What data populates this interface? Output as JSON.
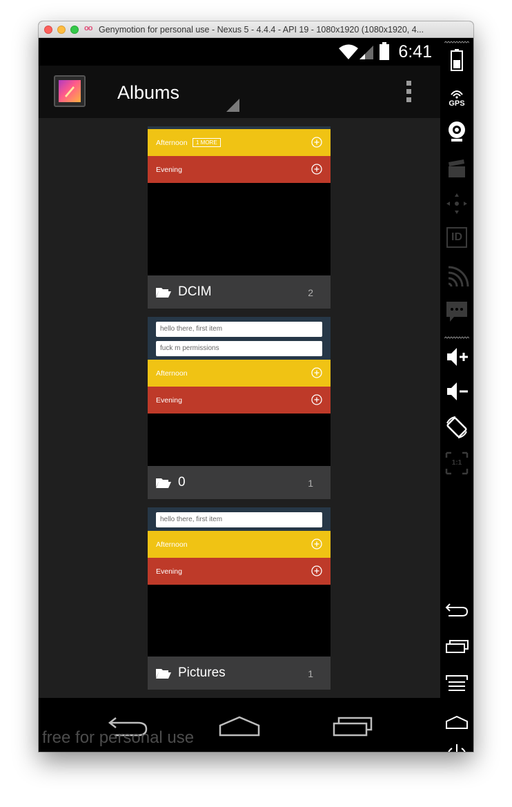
{
  "window": {
    "title": "Genymotion for personal use - Nexus 5 - 4.4.4 - API 19 - 1080x1920 (1080x1920, 4...",
    "logo_text": "oo"
  },
  "statusbar": {
    "time": "6:41"
  },
  "actionbar": {
    "title": "Albums"
  },
  "albums": [
    {
      "name": "DCIM",
      "count": "2",
      "notes": [],
      "rows": [
        {
          "label": "Afternoon",
          "badge": "1 MORE",
          "color": "#f0c314"
        },
        {
          "label": "Evening",
          "color": "#be3a29"
        }
      ]
    },
    {
      "name": "0",
      "count": "1",
      "notes": [
        "hello there, first item",
        "fuck m permissions"
      ],
      "rows": [
        {
          "label": "Afternoon",
          "color": "#f0c314"
        },
        {
          "label": "Evening",
          "color": "#be3a29"
        }
      ]
    },
    {
      "name": "Pictures",
      "count": "1",
      "notes": [
        "hello there, first item"
      ],
      "rows": [
        {
          "label": "Afternoon",
          "color": "#f0c314"
        },
        {
          "label": "Evening",
          "color": "#be3a29"
        }
      ]
    }
  ],
  "watermark": "free for personal use",
  "sidebar_icons": [
    "battery-icon",
    "gps-icon",
    "webcam-icon",
    "video-capture-icon",
    "navigation-pad-icon",
    "device-id-icon",
    "cast-icon",
    "sms-icon",
    "volume-up-icon",
    "volume-down-icon",
    "rotate-icon",
    "scale-icon",
    "back-icon",
    "recent-apps-icon",
    "menu-icon",
    "home-icon",
    "power-icon"
  ],
  "sidebar_labels": {
    "gps": "GPS",
    "id": "ID",
    "scale": "1:1"
  }
}
